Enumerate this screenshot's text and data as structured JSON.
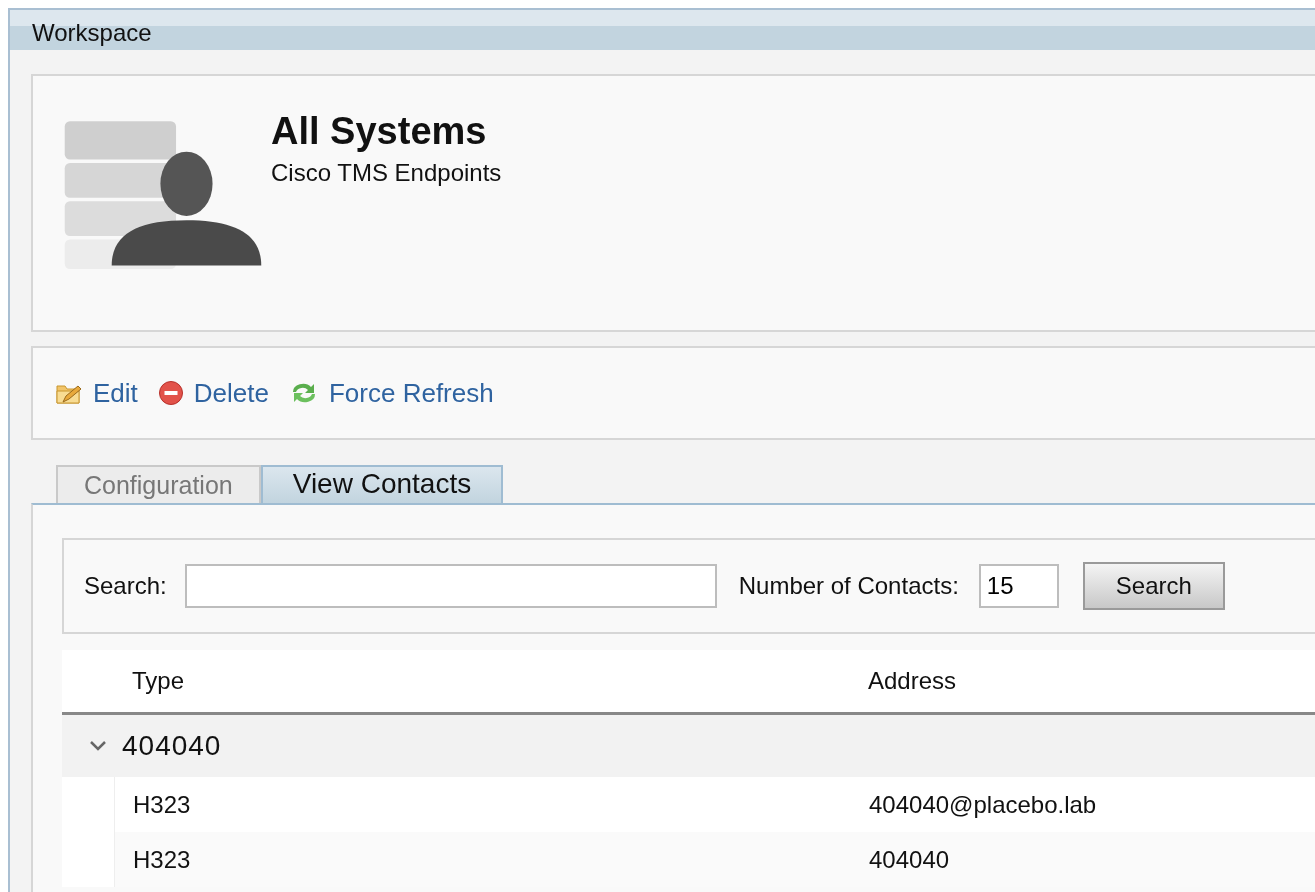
{
  "window": {
    "title": "Workspace"
  },
  "header": {
    "title": "All Systems",
    "subtitle": "Cisco TMS Endpoints"
  },
  "toolbar": [
    {
      "label": "Edit",
      "kind": "edit"
    },
    {
      "label": "Delete",
      "kind": "delete"
    },
    {
      "label": "Force Refresh",
      "kind": "refresh"
    }
  ],
  "tabs": [
    {
      "label": "Configuration",
      "selected": false
    },
    {
      "label": "View Contacts",
      "selected": true
    }
  ],
  "search": {
    "label": "Search:",
    "count_label": "Number of Contacts:",
    "count_value": "15",
    "button": "Search"
  },
  "table": {
    "columns": [
      "Type",
      "Address"
    ],
    "groups": [
      {
        "label": "404040",
        "expanded": true,
        "rows": [
          {
            "type": "H323",
            "address": "404040@placebo.lab"
          },
          {
            "type": "H323",
            "address": "404040"
          }
        ]
      }
    ]
  }
}
